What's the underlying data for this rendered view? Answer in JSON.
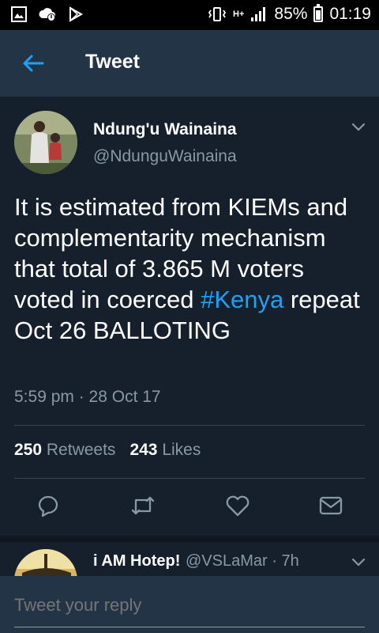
{
  "status_bar": {
    "battery": "85%",
    "time": "01:19",
    "network": "H+"
  },
  "header": {
    "title": "Tweet"
  },
  "tweet": {
    "author_name": "Ndung'u Wainaina",
    "author_handle": "@NdunguWainaina",
    "text_before": "It is estimated from KIEMs and complementarity mechanism that total of 3.865 M voters voted in coerced ",
    "hashtag": "#Kenya",
    "text_after": " repeat Oct 26 BALLOTING",
    "timestamp": "5:59 pm · 28 Oct 17",
    "retweets_count": "250",
    "retweets_label": "Retweets",
    "likes_count": "243",
    "likes_label": "Likes"
  },
  "reply": {
    "name": "i AM Hotep!",
    "handle_time": "@VSLaMar · 7h"
  },
  "compose": {
    "placeholder": "Tweet your reply"
  },
  "colors": {
    "accent": "#1da1f2",
    "background": "#16202c",
    "header": "#243447",
    "muted_text": "#8899a6"
  },
  "icons": [
    "back-arrow-icon",
    "chevron-down-icon",
    "reply-icon",
    "retweet-icon",
    "like-icon",
    "message-icon"
  ]
}
